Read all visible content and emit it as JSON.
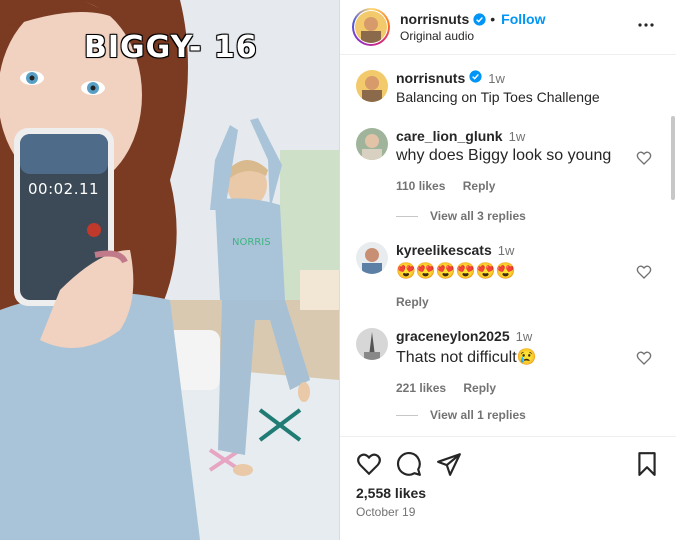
{
  "media": {
    "overlay_caption": "BIGGY- 16",
    "timer_text": "00:02.11"
  },
  "header": {
    "username": "norrisnuts",
    "separator": "•",
    "follow_label": "Follow",
    "audio_label": "Original audio"
  },
  "caption": {
    "username": "norrisnuts",
    "time": "1w",
    "text": "Balancing on Tip Toes Challenge"
  },
  "comments": [
    {
      "username": "care_lion_glunk",
      "time": "1w",
      "text": "why does Biggy look so young",
      "likes": "110 likes",
      "reply_label": "Reply",
      "view_replies": "View all 3 replies"
    },
    {
      "username": "kyreelikescats",
      "time": "1w",
      "text": "😍😍😍😍😍😍",
      "reply_label": "Reply"
    },
    {
      "username": "graceneylon2025",
      "time": "1w",
      "text": "Thats not difficult😢",
      "likes": "221 likes",
      "reply_label": "Reply",
      "view_replies": "View all 1 replies"
    }
  ],
  "footer": {
    "likes": "2,558 likes",
    "date": "October 19"
  },
  "colors": {
    "accent": "#0095f6",
    "secondary_text": "#737373",
    "verified": "#0095f6"
  },
  "icons": [
    "more-icon",
    "verified-icon",
    "heart-icon",
    "comment-icon",
    "share-icon",
    "bookmark-icon"
  ]
}
